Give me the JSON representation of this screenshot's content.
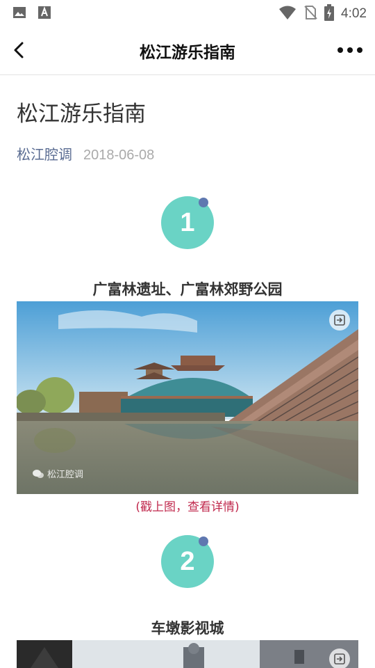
{
  "status_bar": {
    "time": "4:02",
    "icons": [
      "image-icon",
      "font-icon",
      "wifi-icon",
      "no-sim-icon",
      "battery-charging-icon"
    ]
  },
  "nav": {
    "title": "松江游乐指南",
    "back_icon": "chevron-left-icon",
    "more_icon": "more-dots-icon"
  },
  "article": {
    "title": "松江游乐指南",
    "author": "松江腔调",
    "date": "2018-06-08"
  },
  "sections": [
    {
      "number": "1",
      "heading": "广富林遗址、广富林郊野公园",
      "caption": "(戳上图，查看详情)",
      "watermark": "松江腔调"
    },
    {
      "number": "2",
      "heading": "车墩影视城"
    }
  ],
  "colors": {
    "badge": "#6ad3c5",
    "badge_dot": "#5f78b0",
    "author": "#5a6c92",
    "caption": "#c0294d"
  }
}
